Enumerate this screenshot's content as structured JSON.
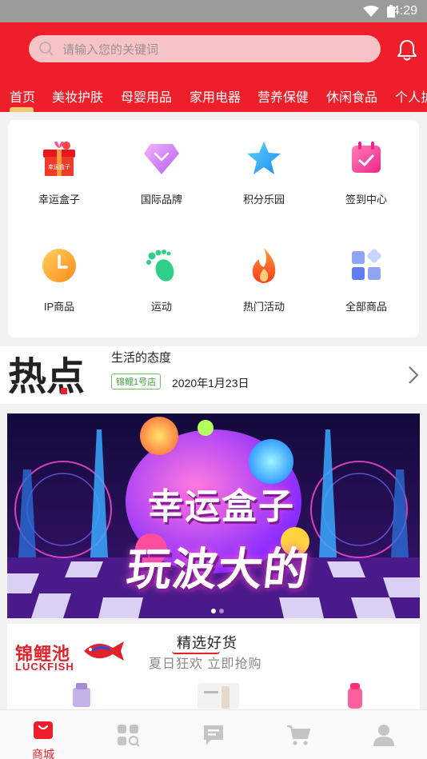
{
  "status": {
    "time": "4:29"
  },
  "header": {
    "search_placeholder": "请输入您的关键词",
    "categories": [
      "首页",
      "美妆护肤",
      "母婴用品",
      "家用电器",
      "营养保健",
      "休闲食品",
      "个人护"
    ],
    "active_category_index": 0
  },
  "grid": [
    {
      "label": "幸运盒子",
      "icon": "gift-box-icon",
      "badge": "幸运盒子"
    },
    {
      "label": "国际品牌",
      "icon": "diamond-icon"
    },
    {
      "label": "积分乐园",
      "icon": "star-icon"
    },
    {
      "label": "签到中心",
      "icon": "calendar-check-icon"
    },
    {
      "label": "IP商品",
      "icon": "clock-icon"
    },
    {
      "label": "运动",
      "icon": "footprint-icon"
    },
    {
      "label": "热门活动",
      "icon": "flame-icon"
    },
    {
      "label": "全部商品",
      "icon": "category-blocks-icon"
    }
  ],
  "hot": {
    "logo_text": "热点",
    "title": "生活的态度",
    "tag": "锦鲤1号店",
    "date": "2020年1月23日"
  },
  "banner": {
    "line1": "幸运盒子",
    "line2": "玩波大的",
    "colors": {
      "bg": "#2a0f55",
      "pink": "#ff3fb0",
      "purple": "#8a3cff",
      "cyan": "#33d6ff",
      "yellow": "#ffd33d"
    }
  },
  "store": {
    "logo_cn": "锦鲤池",
    "logo_en": "LUCKFISH",
    "title": "精选好货",
    "subtitle": "夏日狂欢 立即抢购"
  },
  "tabbar": [
    {
      "label": "商城",
      "icon": "shop-bag-icon",
      "active": true
    },
    {
      "label": "",
      "icon": "category-search-icon",
      "active": false
    },
    {
      "label": "",
      "icon": "message-icon",
      "active": false
    },
    {
      "label": "",
      "icon": "cart-icon",
      "active": false
    },
    {
      "label": "",
      "icon": "user-icon",
      "active": false
    }
  ],
  "colors": {
    "brand_red": "#ee1f2a",
    "tab_inactive": "#c4c4c4"
  }
}
